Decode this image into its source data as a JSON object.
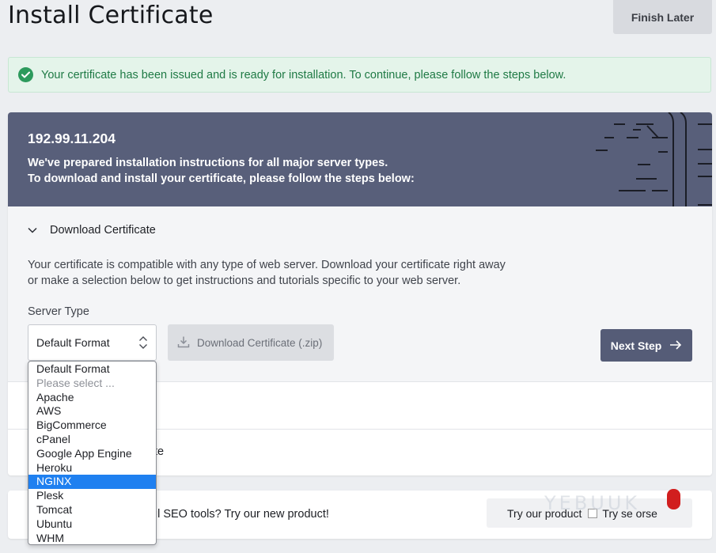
{
  "header": {
    "title": "Install Certificate",
    "finish_later": "Finish Later"
  },
  "alert": {
    "text": "Your certificate has been issued and is ready for installation. To continue, please follow the steps below.",
    "color": "#2c9a5c"
  },
  "hero": {
    "ip": "192.99.11.204",
    "line1": "We've prepared installation instructions for all major server types.",
    "line2": "To download and install your certificate, please follow the steps below:",
    "background": "#585f7a"
  },
  "download_section": {
    "title": "Download Certificate",
    "description": "Your certificate is compatible with any type of web server. Download your certificate right away or make a selection below to get instructions and tutorials specific to your web server.",
    "server_type_label": "Server Type",
    "select_value": "Default Format",
    "download_button": "Download Certificate (.zip)",
    "next_button": "Next Step"
  },
  "collapsed_row_partial_text": "te",
  "dropdown": {
    "options": [
      "Default Format",
      "Please select ...",
      "Apache",
      "AWS",
      "BigCommerce",
      "cPanel",
      "Google App Engine",
      "Heroku",
      "NGINX",
      "Plesk",
      "Tomcat",
      "Ubuntu",
      "WHM"
    ],
    "highlighted": "NGINX",
    "highlight_color": "#1f80f0"
  },
  "promo": {
    "message": "ful SEO tools? Try our new product!",
    "button_part1": "Try our product",
    "button_part2": "Try se  orse",
    "watermark": "YEBUUK"
  }
}
